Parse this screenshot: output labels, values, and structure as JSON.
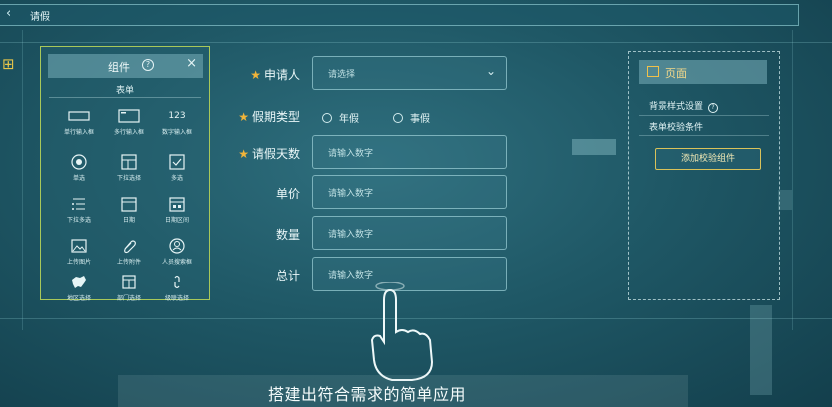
{
  "window": {
    "back_icon": "chevron-left-icon",
    "title": "请假"
  },
  "palette": {
    "title": "组件",
    "section": "表单",
    "items": [
      {
        "label": "单行输入框",
        "icon": "single-line-input-icon"
      },
      {
        "label": "多行输入框",
        "icon": "multi-line-input-icon"
      },
      {
        "label": "数字输入框",
        "icon": "number-input-icon",
        "glyph": "123"
      },
      {
        "label": "单选",
        "icon": "radio-icon"
      },
      {
        "label": "下拉选择",
        "icon": "dropdown-select-icon"
      },
      {
        "label": "多选",
        "icon": "checkbox-icon"
      },
      {
        "label": "下拉多选",
        "icon": "dropdown-multi-icon"
      },
      {
        "label": "日期",
        "icon": "date-icon"
      },
      {
        "label": "日期区间",
        "icon": "date-range-icon"
      },
      {
        "label": "上传图片",
        "icon": "upload-image-icon"
      },
      {
        "label": "上传附件",
        "icon": "upload-attachment-icon"
      },
      {
        "label": "人员搜索框",
        "icon": "person-search-icon"
      },
      {
        "label": "地区选择",
        "icon": "region-select-icon"
      },
      {
        "label": "部门选择",
        "icon": "department-select-icon"
      },
      {
        "label": "级联选择",
        "icon": "cascade-select-icon"
      }
    ]
  },
  "form": {
    "applicant": {
      "label": "申请人",
      "placeholder": "请选择",
      "required": true
    },
    "leave_type": {
      "label": "假期类型",
      "required": true,
      "options": [
        "年假",
        "事假"
      ]
    },
    "days": {
      "label": "请假天数",
      "placeholder": "请输入数字",
      "required": true
    },
    "unit_price": {
      "label": "单价",
      "placeholder": "请输入数字"
    },
    "quantity": {
      "label": "数量",
      "placeholder": "请输入数字"
    },
    "total": {
      "label": "总计",
      "placeholder": "请输入数字"
    }
  },
  "right_panel": {
    "title": "页面",
    "items": [
      "背景样式设置",
      "表单校验条件"
    ],
    "add_button": "添加校验组件"
  },
  "caption": "搭建出符合需求的简单应用",
  "colors": {
    "accent": "#f0b43a",
    "palette_border": "#a8c85a",
    "background": "#1f5866"
  }
}
